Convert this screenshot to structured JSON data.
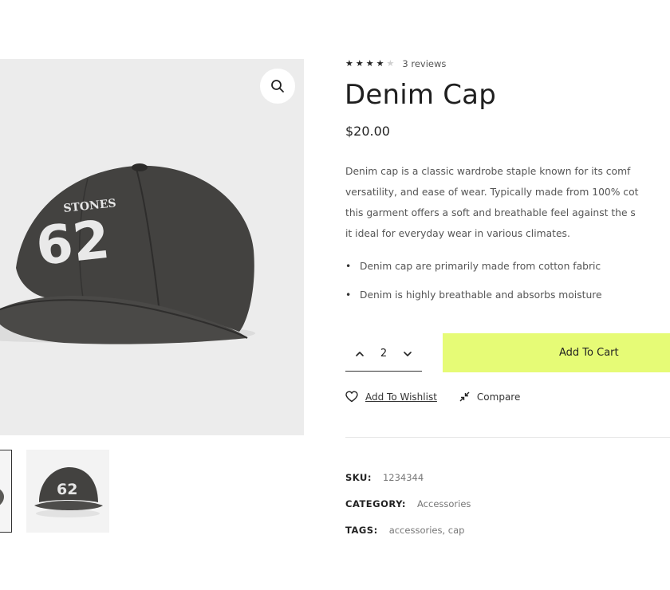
{
  "product": {
    "title": "Denim Cap",
    "price": "$20.00",
    "rating": {
      "value": 4,
      "max": 5,
      "reviews_label": "3 reviews"
    },
    "description_lines": [
      "Denim cap is a classic wardrobe staple known for its comf",
      "versatility, and ease of wear. Typically made from 100% cot",
      "this garment offers a soft and breathable feel against the s",
      "it ideal for everyday wear in various climates."
    ],
    "features": [
      "Denim cap are primarily made from cotton fabric",
      "Denim is highly breathable and absorbs moisture"
    ],
    "cap_print": {
      "brand": "STONES",
      "number": "62"
    }
  },
  "purchase": {
    "quantity": "2",
    "add_to_cart_label": "Add To Cart",
    "wishlist_label": "Add To Wishlist",
    "compare_label": "Compare"
  },
  "meta": {
    "sku_label": "SKU:",
    "sku_value": "1234344",
    "category_label": "CATEGORY:",
    "category_value": "Accessories",
    "tags_label": "TAGS:",
    "tags_value": "accessories, cap"
  },
  "icons": {
    "zoom": "search-icon",
    "qty_up": "chevron-up-icon",
    "qty_down": "chevron-down-icon",
    "wishlist": "heart-icon",
    "compare": "compare-arrows-icon"
  },
  "colors": {
    "accent": "#e6fb76",
    "cap": "#3e3d3b",
    "image_bg": "#ececec"
  }
}
